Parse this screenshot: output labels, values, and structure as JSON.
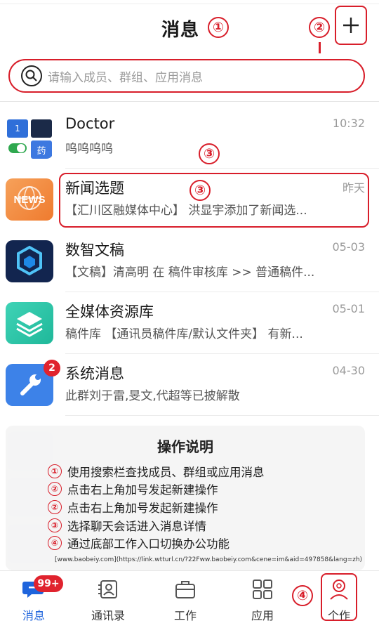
{
  "header": {
    "title": "消息"
  },
  "annotations": {
    "n1": "①",
    "n2": "②",
    "n3a": "③",
    "n3b": "③",
    "n4": "④"
  },
  "search": {
    "placeholder": "请输入成员、群组、应用消息"
  },
  "conversations": [
    {
      "name": "Doctor",
      "preview": "呜呜呜呜",
      "time": "10:32",
      "avatar_text": [
        "1",
        "药"
      ]
    },
    {
      "name": "新闻选题",
      "preview": "【汇川区融媒体中心】 洪显宇添加了新闻选...",
      "time": "昨天",
      "avatar_text": "NEWS"
    },
    {
      "name": "数智文稿",
      "preview": "【文稿】清高明 在 稿件审核库 >> 普通稿件...",
      "time": "05-03"
    },
    {
      "name": "全媒体资源库",
      "preview": "稿件库 【通讯员稿件库/默认文件夹】 有新...",
      "time": "05-01"
    },
    {
      "name": "系统消息",
      "preview": "此群刘于雷,旻文,代超等已披解散",
      "time": "04-30",
      "badge": "2"
    }
  ],
  "instructions": {
    "title": "操作说明",
    "steps": [
      {
        "num": "①",
        "text": "使用搜索栏查找成员、群组或应用消息"
      },
      {
        "num": "②",
        "text": "点击右上角加号发起新建操作"
      },
      {
        "num": "②",
        "text": "点击右上角加号发起新建操作"
      },
      {
        "num": "③",
        "text": "选择聊天会话进入消息详情"
      },
      {
        "num": "④",
        "text": "通过底部工作入口切换办公功能"
      }
    ],
    "source": "[www.baobeiy.com](https://link.wtturl.cn/?22Fww.baobeiy.com&cene=im&aid=497858&lang=zh)"
  },
  "tabbar": {
    "items": [
      {
        "label": "消息",
        "badge": "99+"
      },
      {
        "label": "通讯录"
      },
      {
        "label": "工作"
      },
      {
        "label": "应用"
      },
      {
        "label": "个作"
      }
    ]
  },
  "colors": {
    "accent": "#d81e2a",
    "active_tab": "#1e64dc",
    "badge": "#e0232e"
  }
}
